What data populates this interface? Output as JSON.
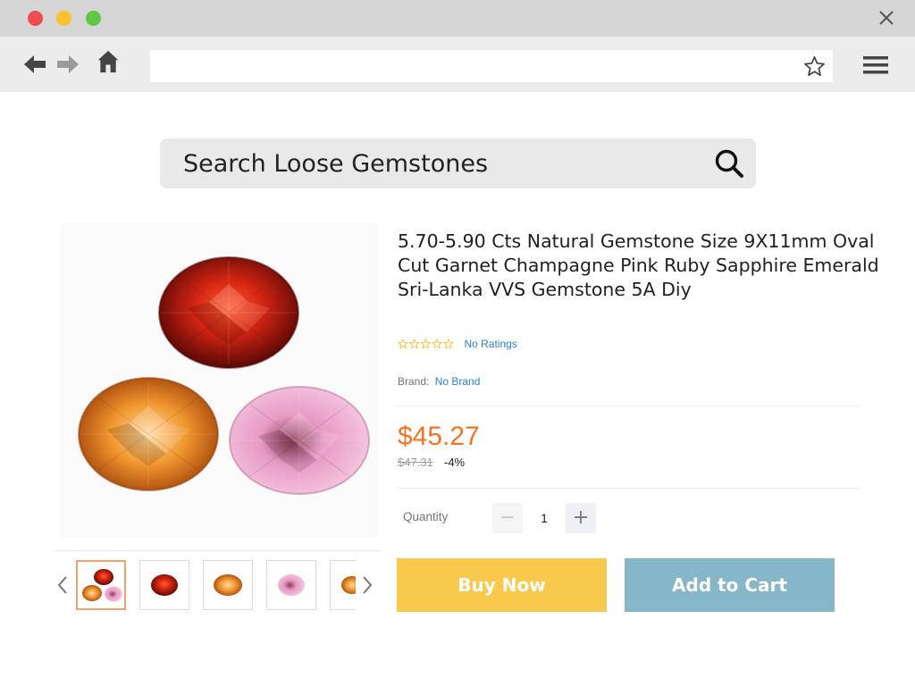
{
  "browser": {
    "url": "",
    "colors": {
      "close": "#ee4c4e",
      "minimize": "#f9c232",
      "maximize": "#60c643"
    }
  },
  "search": {
    "placeholder": "Search Loose Gemstones"
  },
  "product": {
    "title": "5.70-5.90 Cts Natural Gemstone Size 9X11mm Oval Cut Garnet Champagne Pink Ruby Sapphire Emerald Sri-Lanka VVS Gemstone 5A Diy",
    "rating_text": "No Ratings",
    "rating_stars": 0,
    "brand_label": "Brand:",
    "brand_value": "No Brand",
    "price": "$45.27",
    "original_price": "$47.31",
    "discount": "-4%",
    "quantity_label": "Quantity",
    "quantity": "1",
    "qty_minus": "−",
    "qty_plus": "+",
    "buy_now": "Buy Now",
    "add_to_cart": "Add to Cart"
  },
  "gallery": {
    "thumbnails": [
      "three-gemstones",
      "red-garnet",
      "champagne-gem",
      "pink-gem",
      "champagne-gem-partial"
    ],
    "active_index": 0
  },
  "colors": {
    "price": "#f57224",
    "buy_now": "#f9c94d",
    "add_to_cart": "#86b7c8",
    "link": "#2a84c4"
  },
  "icons": [
    "back-arrow-icon",
    "forward-arrow-icon",
    "home-icon",
    "bookmark-star-icon",
    "hamburger-menu-icon",
    "close-icon",
    "search-icon",
    "chevron-left-icon",
    "chevron-right-icon"
  ]
}
